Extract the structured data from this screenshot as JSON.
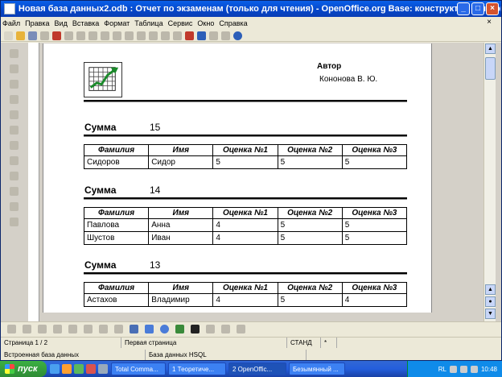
{
  "window": {
    "title": "Новая база данных2.odb : Отчет по экзаменам (только для чтения) - OpenOffice.org Base: конструктор отчетов"
  },
  "menu": [
    "Файл",
    "Правка",
    "Вид",
    "Вставка",
    "Формат",
    "Таблица",
    "Сервис",
    "Окно",
    "Справка"
  ],
  "report": {
    "author_label": "Автор",
    "author_value": "Кононова В. Ю.",
    "columns": [
      "Фамилия",
      "Имя",
      "Оценка №1",
      "Оценка №2",
      "Оценка №3"
    ],
    "groups": [
      {
        "sum_label": "Сумма",
        "sum_value": "15",
        "rows": [
          [
            "Сидоров",
            "Сидор",
            "5",
            "5",
            "5"
          ]
        ]
      },
      {
        "sum_label": "Сумма",
        "sum_value": "14",
        "rows": [
          [
            "Павлова",
            "Анна",
            "4",
            "5",
            "5"
          ],
          [
            "Шустов",
            "Иван",
            "4",
            "5",
            "5"
          ]
        ]
      },
      {
        "sum_label": "Сумма",
        "sum_value": "13",
        "rows": [
          [
            "Астахов",
            "Владимир",
            "4",
            "5",
            "4"
          ]
        ]
      }
    ]
  },
  "statusbar": {
    "page": "Страница  1 / 2",
    "style": "Первая страница",
    "mode": "СТАНД",
    "modified": "*"
  },
  "infobar": {
    "db_label": "Встроенная база данных",
    "db_type": "База данных HSQL"
  },
  "taskbar": {
    "start": "пуск",
    "tasks": [
      "Total Comma...",
      "1 Теоретиче...",
      "2 OpenOffic...",
      "Безымянный ..."
    ],
    "lang": "RL",
    "clock": "10:48"
  },
  "colors": {
    "titlebar": "#0A5FE8",
    "taskbar": "#245EDC",
    "start": "#3CB043"
  }
}
